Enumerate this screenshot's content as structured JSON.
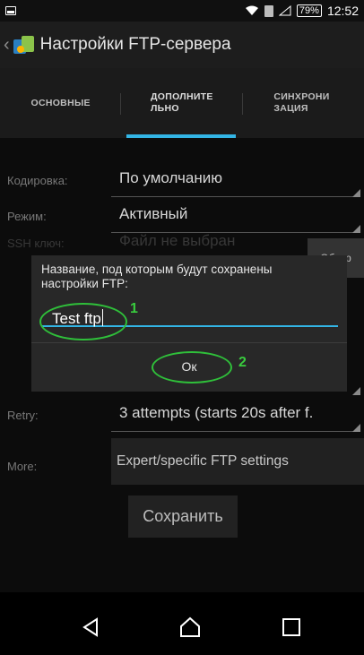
{
  "status_bar": {
    "battery": "79%",
    "time": "12:52"
  },
  "action_bar": {
    "title": "Настройки FTP-сервера"
  },
  "tabs": [
    {
      "label": "ОСНОВНЫЕ",
      "active": false
    },
    {
      "label": "ДОПОЛНИТЕЛЬНО",
      "active": true
    },
    {
      "label": "СИНХРОНИЗАЦИЯ",
      "active": false
    }
  ],
  "settings": {
    "encoding": {
      "label": "Кодировка:",
      "value": "По умолчанию"
    },
    "mode": {
      "label": "Режим:",
      "value": "Активный"
    },
    "ssh_key": {
      "label": "SSH ключ:",
      "value": "Файл не выбран",
      "browse_label": "Обзор"
    },
    "retry": {
      "label": "Retry:",
      "value": "3 attempts (starts 20s after f."
    },
    "more": {
      "label": "More:",
      "value": "Expert/specific FTP settings"
    },
    "save_label": "Сохранить"
  },
  "dialog": {
    "message": "Название, под которым будут сохранены настройки FTP:",
    "input_value": "Test ftp",
    "ok_label": "Ок"
  },
  "annotations": {
    "marker_1": "1",
    "marker_2": "2",
    "color": "#2fbf3a"
  },
  "accent_color": "#33b5e5"
}
